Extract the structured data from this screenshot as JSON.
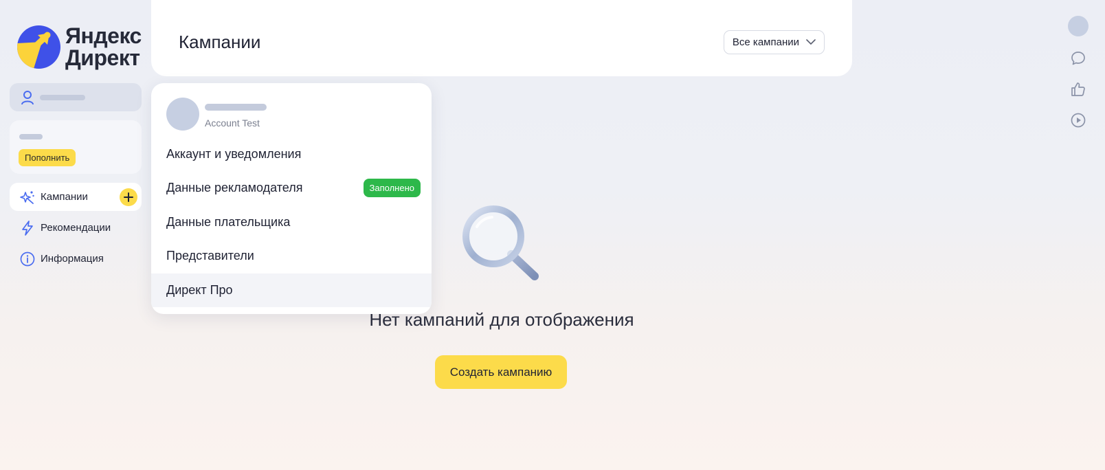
{
  "brand": {
    "line1": "Яндекс",
    "line2": "Директ",
    "colors": {
      "circle": "#3f51e8",
      "accent": "#fcdb4a"
    }
  },
  "sidebar": {
    "topup_label": "Пополнить",
    "items": [
      {
        "label": "Кампании",
        "icon": "sparkle-icon",
        "active": true
      },
      {
        "label": "Рекомендации",
        "icon": "lightning-icon",
        "active": false
      },
      {
        "label": "Информация",
        "icon": "info-icon",
        "active": false
      }
    ]
  },
  "header": {
    "title": "Кампании",
    "filter_value": "Все кампании"
  },
  "user_menu": {
    "account_name": "Account Test",
    "items": [
      {
        "label": "Аккаунт и уведомления"
      },
      {
        "label": "Данные рекламодателя",
        "badge": "Заполнено"
      },
      {
        "label": "Данные плательщика"
      },
      {
        "label": "Представители"
      },
      {
        "label": "Директ Про"
      }
    ],
    "badge_color": "#2db84a"
  },
  "empty_state": {
    "message": "Нет кампаний для отображения",
    "create_label": "Создать кампанию"
  },
  "right_bar": {
    "icons": [
      "avatar",
      "chat-icon",
      "thumbs-up-icon",
      "play-icon"
    ]
  }
}
